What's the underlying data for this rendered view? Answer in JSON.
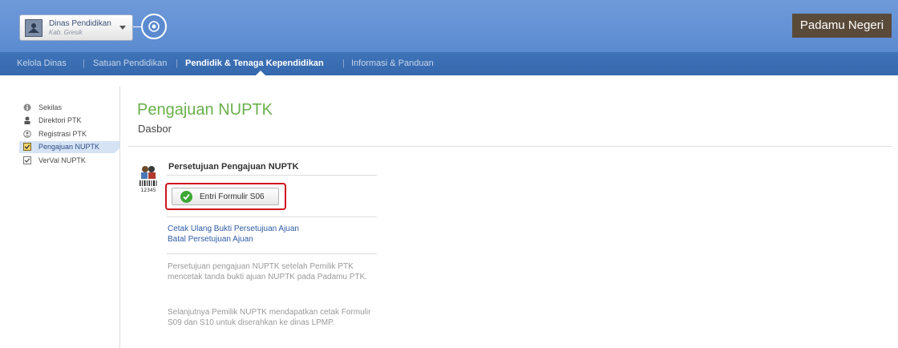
{
  "header": {
    "org_name": "Dinas Pendidikan",
    "org_subtitle": "Kab. Gresik",
    "brand": "Padamu Negeri"
  },
  "nav": {
    "items": [
      "Kelola Dinas",
      "Satuan Pendidikan",
      "Pendidik & Tenaga Kependidikan",
      "Informasi & Panduan"
    ],
    "active_index": 2
  },
  "sidebar": {
    "items": [
      {
        "label": "Sekilas",
        "icon": "info-icon"
      },
      {
        "label": "Direktori PTK",
        "icon": "person-icon"
      },
      {
        "label": "Registrasi PTK",
        "icon": "register-icon"
      },
      {
        "label": "Pengajuan NUPTK",
        "icon": "checkbox-icon"
      },
      {
        "label": "VerVal NUPTK",
        "icon": "checkbox-icon"
      }
    ],
    "active_index": 3
  },
  "main": {
    "title": "Pengajuan NUPTK",
    "subtitle": "Dasbor",
    "section_title": "Persetujuan Pengajuan NUPTK",
    "section_icon_code": "12345",
    "button_label": "Entri Formulir S06",
    "links": [
      "Cetak Ulang Bukti Persetujuan Ajuan",
      "Batal Persetujuan Ajuan"
    ],
    "notes": [
      "Persetujuan pengajuan NUPTK setelah Pemilik PTK mencetak tanda bukti ajuan NUPTK pada Padamu PTK.",
      "Selanjutnya Pemilik NUPTK mendapatkan cetak Formulir S09 dan S10 untuk diserahkan ke dinas LPMP."
    ]
  },
  "colors": {
    "topbar": "#5b8bd1",
    "navbar": "#3568ad",
    "title_green": "#6ab04c",
    "link_blue": "#2d5aa5",
    "highlight_red": "#d0141c"
  }
}
